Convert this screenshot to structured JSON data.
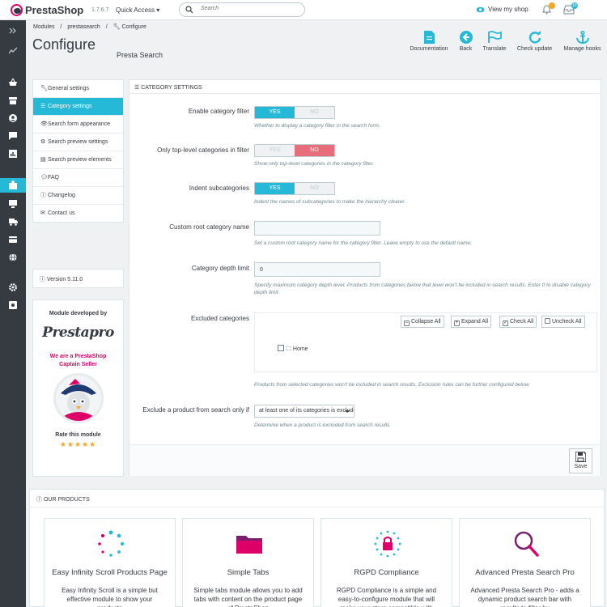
{
  "header": {
    "brand": "PrestaShop",
    "version": "1.7.6.7",
    "quick_access": "Quick Access",
    "search_placeholder": "Search",
    "view_shop": "View my shop",
    "orders_badge": "",
    "notifications_badge": "16"
  },
  "breadcrumb": {
    "items": [
      "Modules",
      "prestasearch",
      "Configure"
    ],
    "separator": "/"
  },
  "page": {
    "title": "Configure",
    "subtitle": "Presta Search"
  },
  "toolbar": {
    "documentation": "Documentation",
    "back": "Back",
    "translate": "Translate",
    "check_update": "Check update",
    "manage_hooks": "Manage hooks"
  },
  "left_nav": {
    "items": [
      {
        "label": "General settings",
        "icon": "wrench-icon"
      },
      {
        "label": "Category settings",
        "icon": "list-icon"
      },
      {
        "label": "Search form appearance",
        "icon": "eye-icon"
      },
      {
        "label": "Search preview settings",
        "icon": "cogs-icon"
      },
      {
        "label": "Search preview elements",
        "icon": "file-icon"
      },
      {
        "label": "FAQ",
        "icon": "comments-icon"
      },
      {
        "label": "Changelog",
        "icon": "info-icon"
      },
      {
        "label": "Contact us",
        "icon": "envelope-icon"
      }
    ],
    "version": "Version 5.11.0"
  },
  "developer": {
    "title": "Module developed by",
    "logo_text": "Prestapro",
    "captain_line1": "We are a PrestaShop",
    "captain_line2": "Captain Seller",
    "rate": "Rate this module",
    "stars": "★★★★★",
    "star_color": "#f5a623"
  },
  "panel": {
    "heading": "CATEGORY SETTINGS",
    "yes": "YES",
    "no": "NO",
    "fields": {
      "enable_filter": {
        "label": "Enable category filter",
        "value": "YES",
        "help": "Whether to display a category filter in the search form."
      },
      "top_level": {
        "label": "Only top-level categories in filter",
        "value": "NO",
        "help": "Show only top-level categories in the category filter."
      },
      "indent": {
        "label": "Indent subcategories",
        "value": "YES",
        "help": "Indent the names of subcategories to make the hierarchy clearer."
      },
      "root_name": {
        "label": "Custom root category name",
        "value": "",
        "help": "Set a custom root category name for the category filter. Leave empty to use the default name."
      },
      "depth": {
        "label": "Category depth limit",
        "value": "0",
        "help": "Specify maximum category depth level. Products from categories below that level won't be included in search results. Enter 0 to disable category depth limit."
      },
      "excluded": {
        "label": "Excluded categories",
        "help": "Products from selected categories won't be included in search results. Exclusion rules can be further configured below.",
        "collapse_all": "Collapse All",
        "expand_all": "Expand All",
        "check_all": "Check All",
        "uncheck_all": "Uncheck All",
        "tree_root": "Home"
      },
      "exclude_rule": {
        "label": "Exclude a product from search only if",
        "value": "at least one of its categories is excluded",
        "help": "Determine when a product is excluded from search results"
      }
    },
    "save": "Save"
  },
  "products": {
    "heading": "OUR PRODUCTS",
    "cards": [
      {
        "title": "Easy Infinity Scroll Products Page",
        "desc": "Easy Infinity Scroll is a simple but effective module to show your products"
      },
      {
        "title": "Simple Tabs",
        "desc": "Simple tabs module allows you to add tabs with content on the product page of PrestaShop"
      },
      {
        "title": "RGPD Compliance",
        "desc": "RGPD Compliance is a simple and easy-to-configure module that will make your store compatible with"
      },
      {
        "title": "Advanced Presta Search Pro",
        "desc": "Advanced Presta Search Pro - adds a dynamic product search bar with results to filter by"
      }
    ]
  },
  "colors": {
    "accent": "#25b9d7",
    "brand_pink": "#df0067",
    "sidebar": "#363a41",
    "no_red": "#e76d7a"
  }
}
